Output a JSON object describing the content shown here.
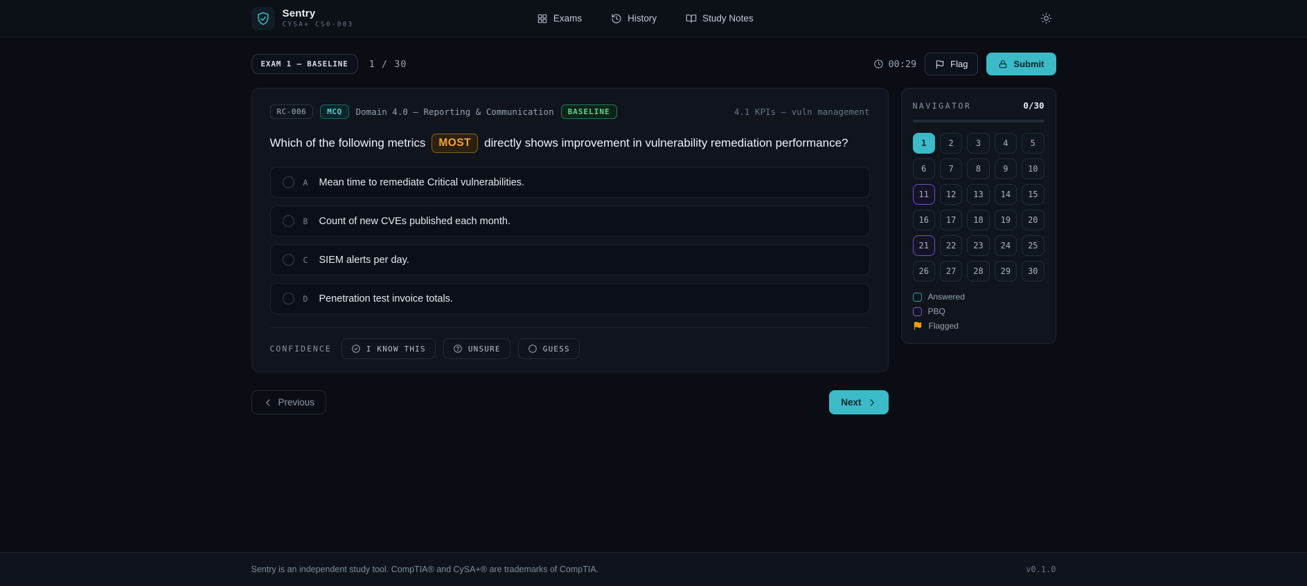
{
  "colors": {
    "accent_teal": "#3cbac8",
    "accent_green": "#58d793",
    "accent_orange": "#f2a43c",
    "accent_purple": "#7c5fd0",
    "flag_orange": "#f59e0b"
  },
  "header": {
    "brand": {
      "name": "Sentry",
      "subtitle": "CYSA+ CS0-003"
    },
    "nav": [
      {
        "label": "Exams",
        "icon": "grid-icon"
      },
      {
        "label": "History",
        "icon": "history-icon"
      },
      {
        "label": "Study Notes",
        "icon": "book-open-icon"
      }
    ]
  },
  "exam_bar": {
    "exam_badge": "EXAM 1 — BASELINE",
    "progress": "1 / 30",
    "timer": "00:29",
    "flag_label": "Flag",
    "submit_label": "Submit"
  },
  "question": {
    "id": "RC-006",
    "type": "MCQ",
    "domain": "Domain 4.0 — Reporting & Communication",
    "difficulty": "BASELINE",
    "topic": "4.1 KPIs — vuln management",
    "text_before": "Which of the following metrics",
    "emphasis": "MOST",
    "text_after": "directly shows improvement in vulnerability remediation performance?",
    "options": [
      {
        "letter": "A",
        "text": "Mean time to remediate Critical vulnerabilities."
      },
      {
        "letter": "B",
        "text": "Count of new CVEs published each month."
      },
      {
        "letter": "C",
        "text": "SIEM alerts per day."
      },
      {
        "letter": "D",
        "text": "Penetration test invoice totals."
      }
    ],
    "confidence": {
      "label": "CONFIDENCE",
      "buttons": [
        {
          "label": "I KNOW THIS",
          "icon": "check-circle-icon"
        },
        {
          "label": "UNSURE",
          "icon": "help-circle-icon"
        },
        {
          "label": "GUESS",
          "icon": "circle-icon"
        }
      ]
    }
  },
  "navigator": {
    "title": "NAVIGATOR",
    "count": "0/30",
    "progress_percent": 0,
    "current": "1",
    "pbq": [
      "11",
      "21"
    ],
    "cells": [
      "1",
      "2",
      "3",
      "4",
      "5",
      "6",
      "7",
      "8",
      "9",
      "10",
      "11",
      "12",
      "13",
      "14",
      "15",
      "16",
      "17",
      "18",
      "19",
      "20",
      "21",
      "22",
      "23",
      "24",
      "25",
      "26",
      "27",
      "28",
      "29",
      "30"
    ],
    "legend": [
      {
        "label": "Answered",
        "type": "answered"
      },
      {
        "label": "PBQ",
        "type": "pbq"
      },
      {
        "label": "Flagged",
        "type": "flagged"
      }
    ]
  },
  "pager": {
    "previous": "Previous",
    "next": "Next"
  },
  "footer": {
    "disclaimer": "Sentry is an independent study tool. CompTIA® and CySA+® are trademarks of CompTIA.",
    "version": "v0.1.0"
  }
}
